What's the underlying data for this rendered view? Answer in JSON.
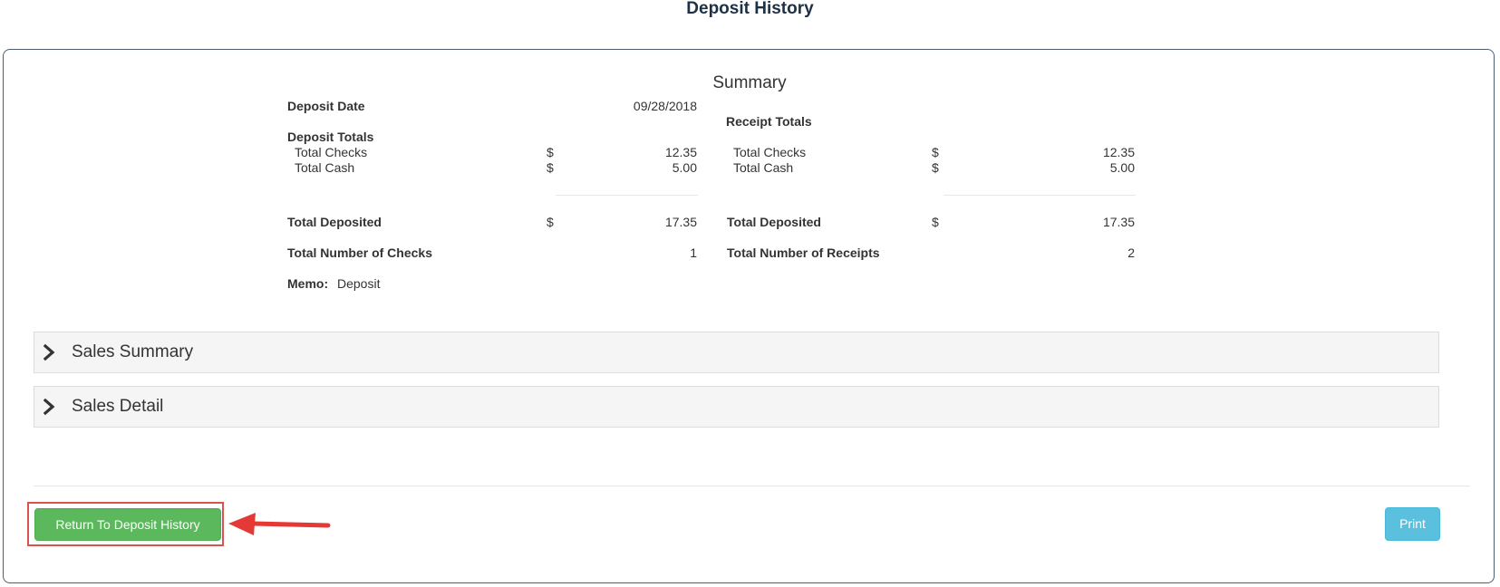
{
  "page": {
    "title": "Deposit History"
  },
  "summary": {
    "title": "Summary",
    "left": {
      "deposit_date_label": "Deposit Date",
      "deposit_date_value": "09/28/2018",
      "deposit_totals_label": "Deposit Totals",
      "total_checks_label": "Total Checks",
      "total_checks_currency": "$",
      "total_checks_value": "12.35",
      "total_cash_label": "Total Cash",
      "total_cash_currency": "$",
      "total_cash_value": "5.00",
      "total_deposited_label": "Total Deposited",
      "total_deposited_currency": "$",
      "total_deposited_value": "17.35",
      "num_checks_label": "Total Number of Checks",
      "num_checks_value": "1",
      "memo_label": "Memo:",
      "memo_value": "Deposit"
    },
    "right": {
      "receipt_totals_label": "Receipt Totals",
      "total_checks_label": "Total Checks",
      "total_checks_currency": "$",
      "total_checks_value": "12.35",
      "total_cash_label": "Total Cash",
      "total_cash_currency": "$",
      "total_cash_value": "5.00",
      "total_deposited_label": "Total Deposited",
      "total_deposited_currency": "$",
      "total_deposited_value": "17.35",
      "num_receipts_label": "Total Number of Receipts",
      "num_receipts_value": "2"
    }
  },
  "accordions": [
    {
      "label": "Sales Summary",
      "icon": "chevron-right-icon"
    },
    {
      "label": "Sales Detail",
      "icon": "chevron-right-icon"
    }
  ],
  "buttons": {
    "return_label": "Return To Deposit History",
    "print_label": "Print"
  },
  "annotation": {
    "highlight_color": "#d9534f",
    "arrow_icon": "red-arrow-icon"
  },
  "colors": {
    "title": "#1e3046",
    "return_button": "#5cb85c",
    "print_button": "#5bc0de",
    "accordion_bg": "#f5f5f5"
  }
}
